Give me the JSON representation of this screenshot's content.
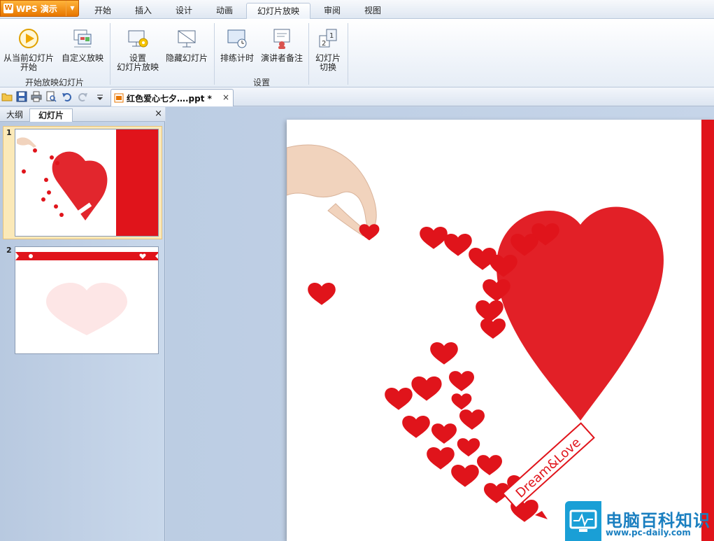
{
  "app": {
    "name": "WPS 演示",
    "logo_glyph": "W"
  },
  "menu": {
    "tabs": [
      "开始",
      "插入",
      "设计",
      "动画",
      "幻灯片放映",
      "审阅",
      "视图"
    ],
    "active": "幻灯片放映"
  },
  "ribbon": {
    "from_current": [
      "从当前幻灯片",
      "开始"
    ],
    "custom_show": "自定义放映",
    "group_start": "开始放映幻灯片",
    "setup_show": [
      "设置",
      "幻灯片放映"
    ],
    "hide_slide": "隐藏幻灯片",
    "rehearse": "排练计时",
    "presenter_notes": "演讲者备注",
    "group_setup": "设置",
    "transition": [
      "幻灯片",
      "切换"
    ]
  },
  "document": {
    "tab_name": "红色爱心七夕….ppt *",
    "close": "×"
  },
  "panel": {
    "tab_outline": "大纲",
    "tab_slides": "幻灯片",
    "close": "×",
    "slide_numbers": [
      "1",
      "2"
    ]
  },
  "slide": {
    "ribbon_text": "Dream&Love"
  },
  "watermark": {
    "title": "电脑百科知识",
    "url": "www.pc-daily.com"
  },
  "colors": {
    "accent_red": "#e0141b",
    "app_orange": "#e77600",
    "watermark_blue": "#1a7fc0"
  }
}
